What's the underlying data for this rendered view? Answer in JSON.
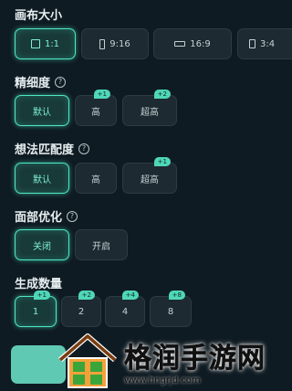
{
  "canvas_size": {
    "title": "画布大小",
    "options": [
      {
        "label": "1:1",
        "selected": true
      },
      {
        "label": "9:16",
        "selected": false
      },
      {
        "label": "16:9",
        "selected": false
      },
      {
        "label": "3:4",
        "selected": false
      }
    ]
  },
  "fineness": {
    "title": "精细度",
    "help": "?",
    "options": [
      {
        "label": "默认",
        "selected": true,
        "badge": ""
      },
      {
        "label": "高",
        "selected": false,
        "badge": "+1"
      },
      {
        "label": "超高",
        "selected": false,
        "badge": "+2"
      }
    ]
  },
  "idea_match": {
    "title": "想法匹配度",
    "help": "?",
    "options": [
      {
        "label": "默认",
        "selected": true,
        "badge": ""
      },
      {
        "label": "高",
        "selected": false,
        "badge": ""
      },
      {
        "label": "超高",
        "selected": false,
        "badge": "+1"
      }
    ]
  },
  "face_opt": {
    "title": "面部优化",
    "help": "?",
    "options": [
      {
        "label": "关闭",
        "selected": true
      },
      {
        "label": "开启",
        "selected": false
      }
    ]
  },
  "gen_count": {
    "title": "生成数量",
    "options": [
      {
        "label": "1",
        "selected": true,
        "badge": "+1"
      },
      {
        "label": "2",
        "selected": false,
        "badge": "+2"
      },
      {
        "label": "4",
        "selected": false,
        "badge": "+4"
      },
      {
        "label": "8",
        "selected": false,
        "badge": "+8"
      }
    ]
  },
  "watermark": {
    "title": "格润手游网",
    "url": "www.hngrjd.com"
  },
  "colors": {
    "background": "#0f1b22",
    "accent": "#4ee8c5",
    "badge": "#4fd7b8"
  }
}
